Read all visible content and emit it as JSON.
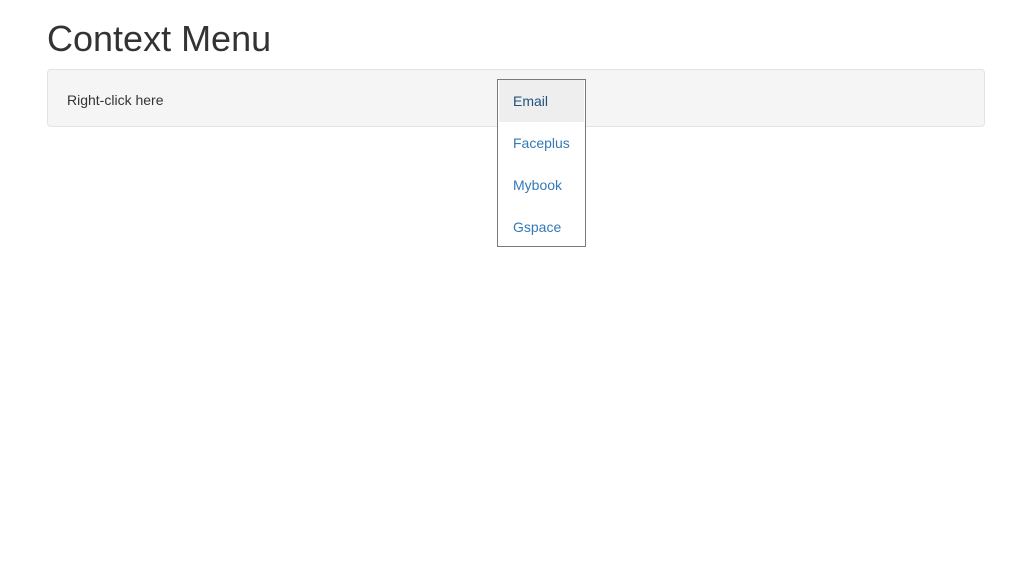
{
  "page": {
    "title": "Context Menu"
  },
  "well": {
    "text": "Right-click here"
  },
  "context_menu": {
    "items": [
      {
        "label": "Email"
      },
      {
        "label": "Faceplus"
      },
      {
        "label": "Mybook"
      },
      {
        "label": "Gspace"
      }
    ],
    "hover_index": 0
  },
  "colors": {
    "link": "#337ab7",
    "link_hover": "#23527c",
    "well_bg": "#f5f5f5",
    "menu_border": "#7a7a7a",
    "hover_bg": "#eeeeee"
  }
}
